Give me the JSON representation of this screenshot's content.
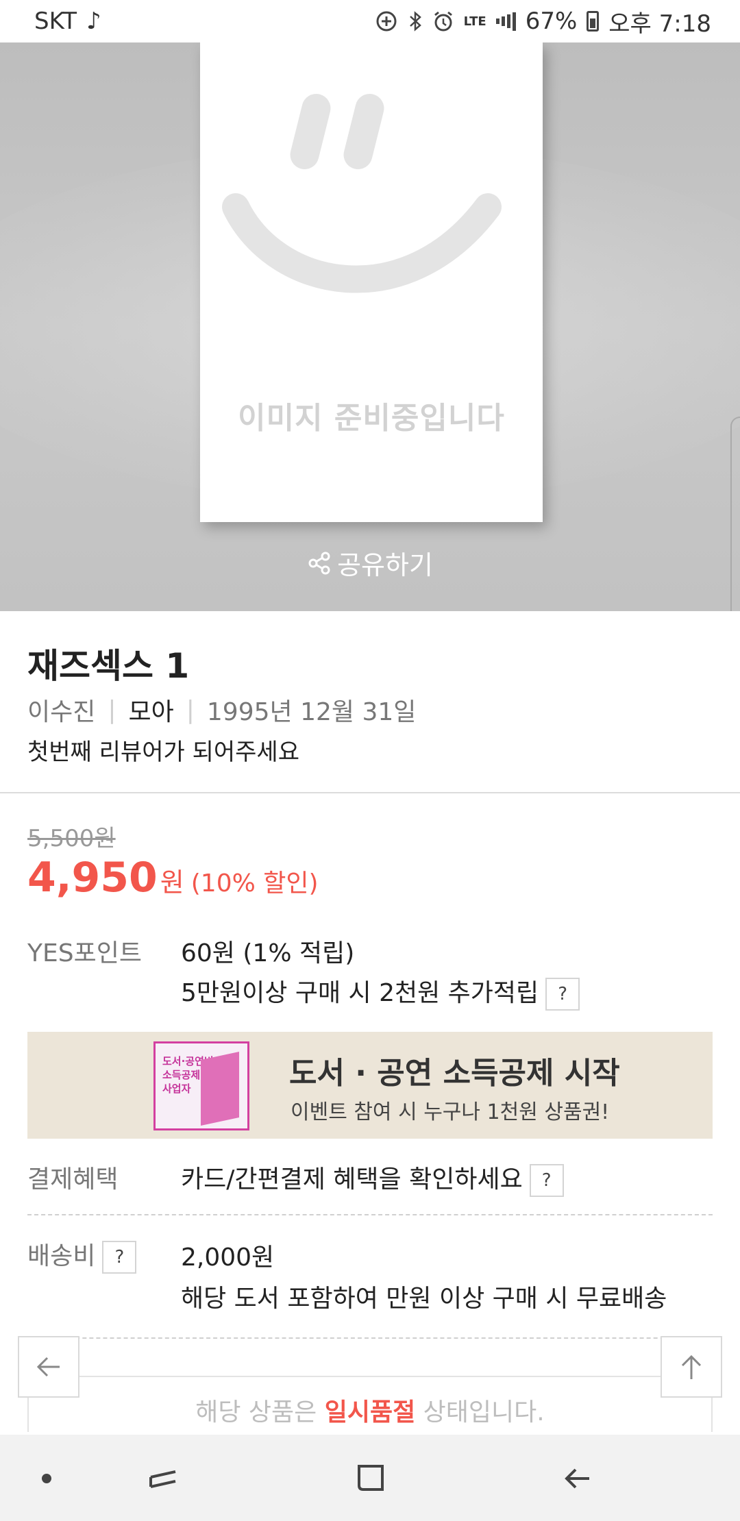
{
  "status_bar": {
    "carrier": "SKT",
    "network": "LTE",
    "battery": "67%",
    "time": "오후 7:18"
  },
  "hero": {
    "placeholder_text": "이미지 준비중입니다",
    "share_label": "공유하기"
  },
  "product": {
    "title": "재즈섹스 1",
    "author": "이수진",
    "publisher": "모아",
    "date": "1995년 12월 31일",
    "review_prompt": "첫번째 리뷰어가 되어주세요"
  },
  "price": {
    "original": "5,500원",
    "sale": "4,950",
    "unit": "원",
    "discount": "(10% 할인)"
  },
  "points": {
    "label": "YES포인트",
    "value": "60원 (1% 적립)",
    "extra": "5만원이상 구매 시 2천원 추가적립",
    "help": "?"
  },
  "banner": {
    "thumb_text": "도서·공연비\n소득공제\n사업자",
    "title": "도서 · 공연 소득공제 시작",
    "subtitle": "이벤트 참여 시 누구나 1천원 상품권!"
  },
  "payment": {
    "label": "결제혜택",
    "value": "카드/간편결제 혜택을 확인하세요",
    "help": "?"
  },
  "shipping": {
    "label": "배송비",
    "help": "?",
    "value": "2,000원",
    "note": "해당 도서 포함하여 만원 이상 구매 시 무료배송"
  },
  "soldout": {
    "prefix": "해당 상품은 ",
    "emphasis": "일시품절",
    "suffix": " 상태입니다."
  },
  "colors": {
    "accent": "#f2564b",
    "banner_bg": "#ece5d8",
    "banner_pink": "#d33fa0"
  }
}
